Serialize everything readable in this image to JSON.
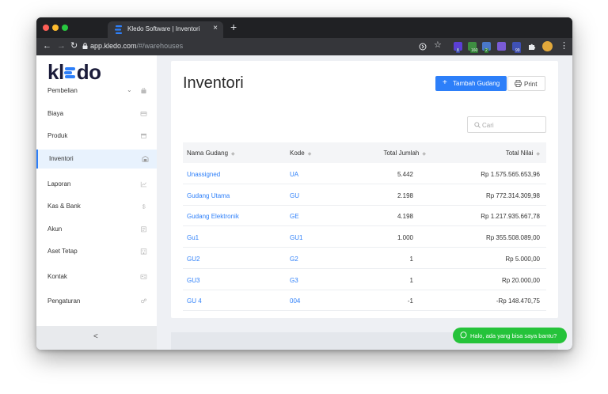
{
  "browser": {
    "tab_title": "Kledo Software | Inventori",
    "tab_close": "×",
    "new_tab": "+",
    "url_host": "app.kledo.com",
    "url_path": "/#/warehouses",
    "extensions": [
      {
        "name": "extension-badge-1",
        "color": "#5b3fd6",
        "badge": "8",
        "badge_color": "#3c4aa8"
      },
      {
        "name": "extension-badge-2",
        "color": "#3e8e41",
        "badge": "160",
        "badge_color": "#2e7d32"
      },
      {
        "name": "extension-badge-3",
        "color": "#4a78c9",
        "badge": "2",
        "badge_color": "#2e7d32"
      },
      {
        "name": "extension-badge-4",
        "color": "#7a5bd6",
        "badge": "",
        "badge_color": ""
      },
      {
        "name": "extension-badge-5",
        "color": "#3f51b5",
        "badge": "99",
        "badge_color": "#3c4aa8"
      }
    ]
  },
  "sidebar": {
    "logo_pre": "kl",
    "logo_post": "do",
    "items": [
      {
        "label": "Pembelian",
        "icon": "bag-icon",
        "has_chevron": true
      },
      {
        "label": "Biaya",
        "icon": "card-icon"
      },
      {
        "label": "Produk",
        "icon": "box-icon"
      },
      {
        "label": "Inventori",
        "icon": "warehouse-icon",
        "active": true
      },
      {
        "label": "Laporan",
        "icon": "chart-icon"
      },
      {
        "label": "Kas & Bank",
        "icon": "dollar-icon"
      },
      {
        "label": "Akun",
        "icon": "ledger-icon"
      },
      {
        "label": "Aset Tetap",
        "icon": "building-icon"
      },
      {
        "label": "Kontak",
        "icon": "contact-card-icon"
      },
      {
        "label": "Pengaturan",
        "icon": "gears-icon"
      }
    ],
    "collapse": "<"
  },
  "main": {
    "title": "Inventori",
    "add_button": "Tambah Gudang",
    "print_button": "Print",
    "search_placeholder": "Cari",
    "columns": [
      "Nama Gudang",
      "Kode",
      "Total Jumlah",
      "Total Nilai"
    ],
    "rows": [
      {
        "name": "Unassigned",
        "code": "UA",
        "qty": "5.442",
        "value": "Rp 1.575.565.653,96"
      },
      {
        "name": "Gudang Utama",
        "code": "GU",
        "qty": "2.198",
        "value": "Rp 772.314.309,98"
      },
      {
        "name": "Gudang Elektronik",
        "code": "GE",
        "qty": "4.198",
        "value": "Rp 1.217.935.667,78"
      },
      {
        "name": "Gu1",
        "code": "GU1",
        "qty": "1.000",
        "value": "Rp 355.508.089,00"
      },
      {
        "name": "GU2",
        "code": "G2",
        "qty": "1",
        "value": "Rp 5.000,00"
      },
      {
        "name": "GU3",
        "code": "G3",
        "qty": "1",
        "value": "Rp 20.000,00"
      },
      {
        "name": "GU 4",
        "code": "004",
        "qty": "-1",
        "value": "-Rp 148.470,75"
      }
    ]
  },
  "whatsapp": {
    "label": "Halo, ada yang bisa saya bantu?"
  },
  "colors": {
    "accent": "#2d7ff9",
    "whatsapp": "#25c33a",
    "sidebar_active": "#e8f2fd"
  }
}
